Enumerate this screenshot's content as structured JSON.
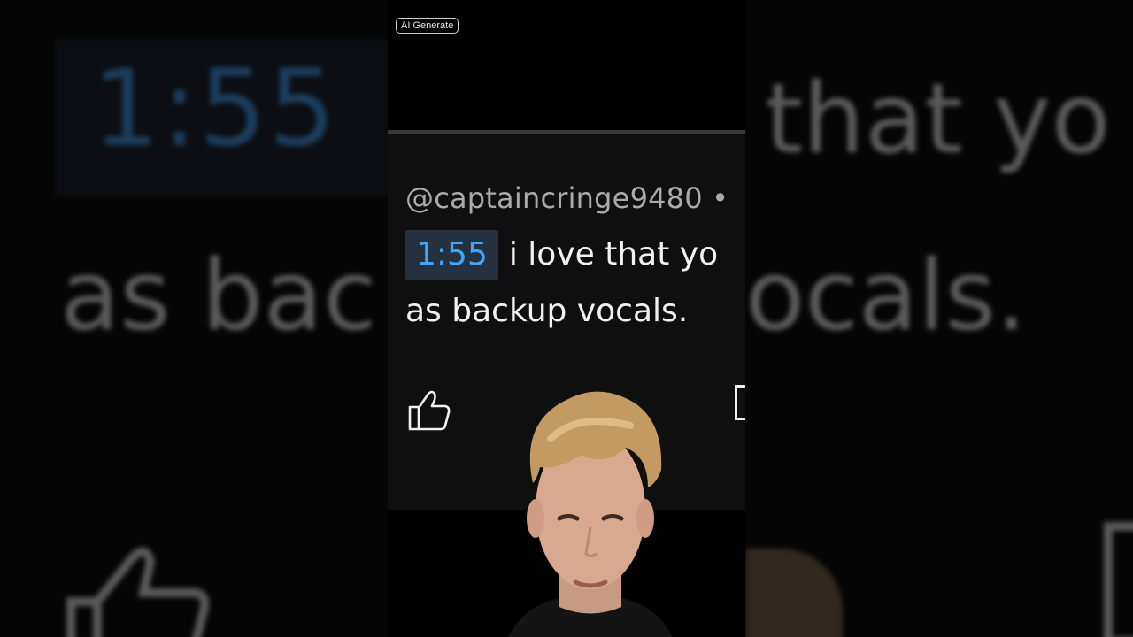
{
  "badge": {
    "label": "AI Generate"
  },
  "comment": {
    "author": "@captaincringe9480 •",
    "timestamp": "1:55",
    "text_line1": "i love that yo",
    "text_line2": "as backup vocals."
  },
  "background": {
    "timestamp": "1:55",
    "left_line2": "as bac",
    "right_line1": "that yo",
    "right_line2": "ocals."
  },
  "icons": {
    "like": "thumbs-up-icon",
    "reply": "comment-icon"
  },
  "colors": {
    "timestamp_text": "#3ea6ff",
    "timestamp_bg": "#26313f",
    "card_bg": "#0f0f0f",
    "secondary_text": "#aaaaaa"
  }
}
